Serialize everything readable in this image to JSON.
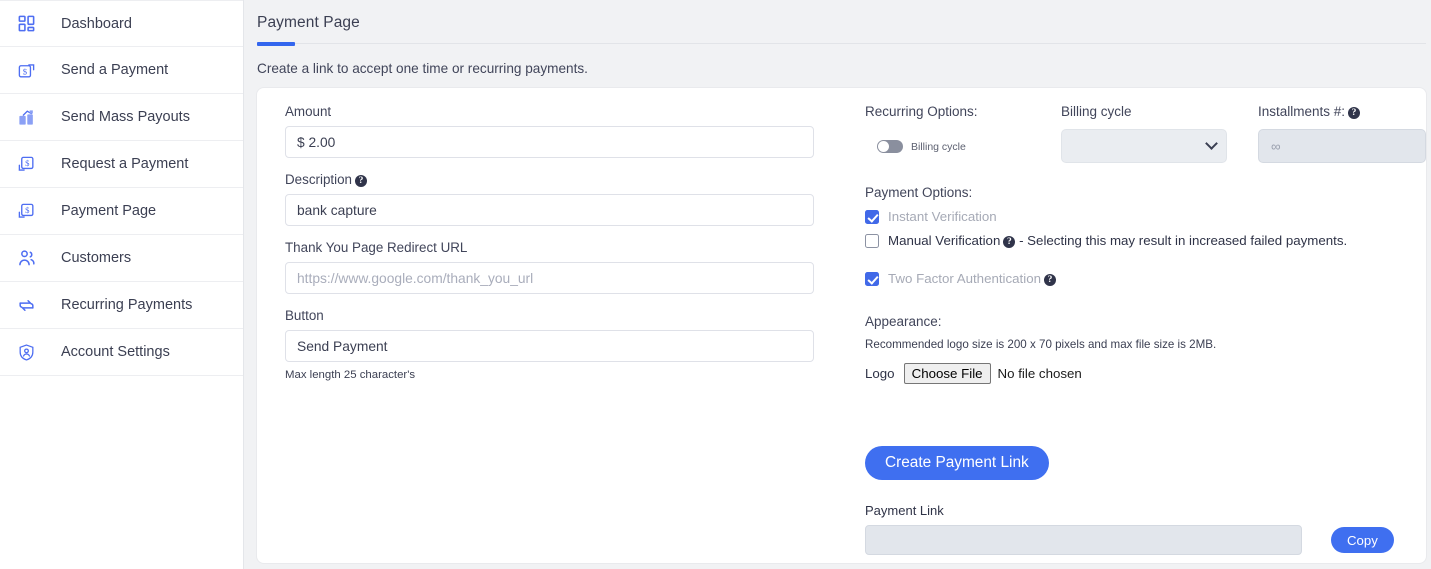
{
  "sidebar": {
    "items": [
      {
        "label": "Dashboard",
        "icon": "dashboard-grid-icon"
      },
      {
        "label": "Send a Payment",
        "icon": "send-payment-icon"
      },
      {
        "label": "Send Mass Payouts",
        "icon": "mass-payouts-icon"
      },
      {
        "label": "Request a Payment",
        "icon": "request-payment-icon"
      },
      {
        "label": "Payment Page",
        "icon": "payment-page-icon"
      },
      {
        "label": "Customers",
        "icon": "customers-icon"
      },
      {
        "label": "Recurring Payments",
        "icon": "recurring-payments-icon"
      },
      {
        "label": "Account Settings",
        "icon": "account-settings-shield-icon"
      }
    ]
  },
  "header": {
    "title": "Payment Page",
    "subtitle": "Create a link to accept one time or recurring payments."
  },
  "form": {
    "amount": {
      "label": "Amount",
      "value": "$ 2.00"
    },
    "description": {
      "label": "Description",
      "value": "bank capture",
      "help": "?"
    },
    "redirect": {
      "label": "Thank You Page Redirect URL",
      "value": "",
      "placeholder": "https://www.google.com/thank_you_url"
    },
    "button": {
      "label": "Button",
      "value": "Send Payment",
      "helper": "Max length 25 character's"
    }
  },
  "recurring": {
    "title": "Recurring Options:",
    "toggle_label": "Billing cycle",
    "toggle_on": false,
    "billing_cycle": {
      "label": "Billing cycle",
      "value": "",
      "options": [
        ""
      ]
    },
    "installments": {
      "label": "Installments #:",
      "help": "?",
      "value": "",
      "placeholder": "∞"
    }
  },
  "payment_options": {
    "title": "Payment Options:",
    "instant": {
      "label": "Instant Verification",
      "checked": true,
      "disabled": true
    },
    "manual": {
      "label": "Manual Verification",
      "help": "?",
      "suffix": "- Selecting this may result in increased failed payments.",
      "checked": false,
      "disabled": false
    },
    "two_factor": {
      "label": "Two Factor Authentication",
      "help": "?",
      "checked": true,
      "disabled": true
    }
  },
  "appearance": {
    "title": "Appearance:",
    "note": "Recommended logo size is 200 x 70 pixels and max file size is 2MB.",
    "logo_label": "Logo",
    "choose_file_label": "Choose File",
    "no_file_text": "No file chosen"
  },
  "actions": {
    "create_label": "Create Payment Link",
    "payment_link_label": "Payment Link",
    "payment_link_value": "",
    "copy_label": "Copy"
  },
  "colors": {
    "accent_blue": "#3366ee",
    "button_blue": "#3f6ff0",
    "icon_blue": "#4e6ef2",
    "page_bg": "#f1f2f4",
    "card_bg": "#ffffff",
    "disabled_bg": "#e2e6ec"
  }
}
